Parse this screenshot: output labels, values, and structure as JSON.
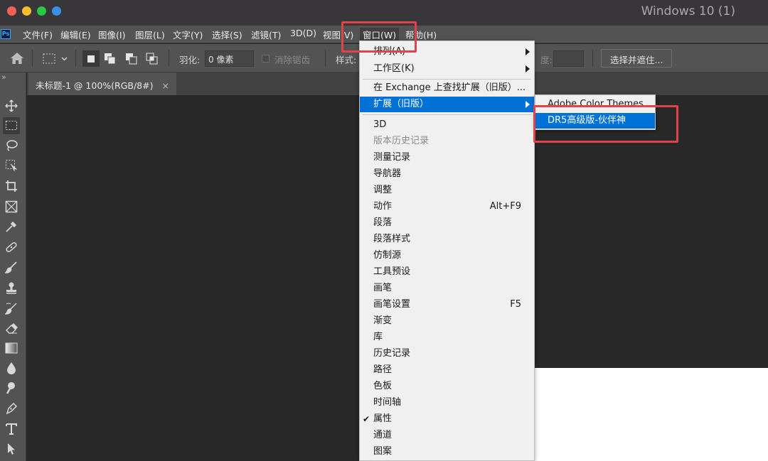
{
  "window": {
    "title": "Windows 10 (1)"
  },
  "traffic_lights": {
    "close_color": "#fe5f57",
    "minimize_color": "#febc2e",
    "zoom_color": "#28c840",
    "extra_color": "#3a8fe6"
  },
  "app": {
    "logo_text": "Ps"
  },
  "menubar": {
    "items": [
      "文件(F)",
      "编辑(E)",
      "图像(I)",
      "图层(L)",
      "文字(Y)",
      "选择(S)",
      "滤镜(T)",
      "3D(D)",
      "视图(V)",
      "窗口(W)",
      "帮助(H)"
    ],
    "active_index": 9
  },
  "options_bar": {
    "feather_label": "羽化:",
    "feather_value": "0 像素",
    "antialias_label": "消除锯齿",
    "style_label": "样式:",
    "height_label": "度:",
    "select_mask_button": "选择并遮住..."
  },
  "document_tab": {
    "title": "未标题-1 @ 100%(RGB/8#)",
    "close_glyph": "×"
  },
  "toolbar": {
    "collapse_glyph": "»",
    "tools": [
      "move-icon",
      "marquee-icon",
      "lasso-icon",
      "object-select-icon",
      "crop-icon",
      "frame-icon",
      "eyedropper-icon",
      "healing-icon",
      "brush-icon",
      "stamp-icon",
      "history-brush-icon",
      "eraser-icon",
      "gradient-icon",
      "blur-icon",
      "dodge-icon",
      "pen-icon",
      "type-icon",
      "path-select-icon"
    ]
  },
  "window_menu": {
    "items": [
      {
        "label": "排列(A)",
        "submenu": true,
        "state": "normal"
      },
      {
        "label": "工作区(K)",
        "submenu": true,
        "state": "normal"
      },
      {
        "label": "在 Exchange 上查找扩展（旧版）...",
        "submenu": false,
        "state": "normal"
      },
      {
        "label": "扩展（旧版）",
        "submenu": true,
        "state": "highlight"
      },
      {
        "label": "3D",
        "state": "normal"
      },
      {
        "label": "版本历史记录",
        "state": "disabled"
      },
      {
        "label": "测量记录",
        "state": "normal"
      },
      {
        "label": "导航器",
        "state": "normal"
      },
      {
        "label": "调整",
        "state": "normal"
      },
      {
        "label": "动作",
        "shortcut": "Alt+F9",
        "state": "normal"
      },
      {
        "label": "段落",
        "state": "normal"
      },
      {
        "label": "段落样式",
        "state": "normal"
      },
      {
        "label": "仿制源",
        "state": "normal"
      },
      {
        "label": "工具预设",
        "state": "normal"
      },
      {
        "label": "画笔",
        "state": "normal"
      },
      {
        "label": "画笔设置",
        "shortcut": "F5",
        "state": "normal"
      },
      {
        "label": "渐变",
        "state": "normal"
      },
      {
        "label": "库",
        "state": "normal"
      },
      {
        "label": "历史记录",
        "state": "normal"
      },
      {
        "label": "路径",
        "state": "normal"
      },
      {
        "label": "色板",
        "state": "normal"
      },
      {
        "label": "时间轴",
        "state": "normal"
      },
      {
        "label": "属性",
        "checked": true,
        "state": "normal"
      },
      {
        "label": "通道",
        "state": "normal"
      },
      {
        "label": "图案",
        "state": "normal"
      }
    ]
  },
  "extensions_submenu": {
    "items": [
      {
        "label": "Adobe Color Themes",
        "state": "normal"
      },
      {
        "label": "DR5高级版-伙伴神",
        "state": "highlight"
      }
    ]
  },
  "colors": {
    "highlight": "#0072d6",
    "annotation_red": "#e0444a"
  }
}
